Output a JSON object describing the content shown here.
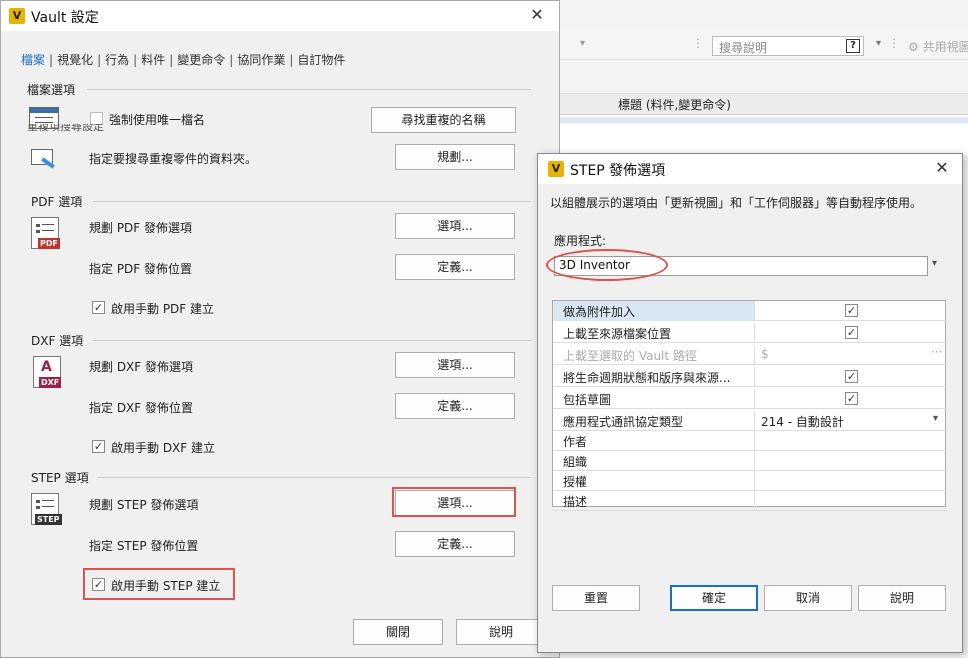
{
  "background": {
    "search_placeholder": "搜尋說明",
    "help_glyph": "?",
    "share_label": "共用視圖",
    "column_title": "標題 (料件,變更命令)"
  },
  "vault_dialog": {
    "title": "Vault 設定",
    "logo": "V",
    "tabs": [
      "檔案",
      "視覺化",
      "行為",
      "料件",
      "變更命令",
      "協同作業",
      "自訂物件"
    ],
    "file_options": {
      "heading": "檔案選項",
      "unique_name_label": "強制使用唯一檔名",
      "find_dup_button": "尋找重複的名稱",
      "dup_search_heading": "重複項搜尋設定",
      "dup_search_label": "指定要搜尋重複零件的資料夾。",
      "plan_button": "規劃..."
    },
    "pdf": {
      "heading": "PDF 選項",
      "badge": "PDF",
      "plan_label": "規劃 PDF 發佈選項",
      "options_button": "選項...",
      "location_label": "指定 PDF 發佈位置",
      "define_button": "定義...",
      "manual_label": "啟用手動 PDF 建立"
    },
    "dxf": {
      "heading": "DXF 選項",
      "badge": "DXF",
      "plan_label": "規劃 DXF 發佈選項",
      "options_button": "選項...",
      "location_label": "指定 DXF 發佈位置",
      "define_button": "定義...",
      "manual_label": "啟用手動 DXF 建立"
    },
    "step": {
      "heading": "STEP 選項",
      "badge": "STEP",
      "plan_label": "規劃 STEP 發佈選項",
      "options_button": "選項...",
      "location_label": "指定 STEP 發佈位置",
      "define_button": "定義...",
      "manual_label": "啟用手動 STEP 建立"
    },
    "close_button": "關閉",
    "help_button": "說明"
  },
  "step_dialog": {
    "title": "STEP 發佈選項",
    "logo": "V",
    "description": "以組體展示的選項由「更新視圖」和「工作伺服器」等自動程序使用。",
    "app_label": "應用程式:",
    "app_value": "3D Inventor",
    "properties": [
      {
        "name": "做為附件加入",
        "value": "",
        "checked": true
      },
      {
        "name": "上載至來源檔案位置",
        "value": "",
        "checked": true
      },
      {
        "name": "上載至選取的 Vault 路徑",
        "value": "$",
        "checked": false
      },
      {
        "name": "將生命週期狀態和版序與來源...",
        "value": "",
        "checked": true
      },
      {
        "name": "包括草圖",
        "value": "",
        "checked": true
      },
      {
        "name": "應用程式通訊協定類型",
        "value": "214 - 自動設計",
        "checked": false
      },
      {
        "name": "作者",
        "value": "",
        "checked": false
      },
      {
        "name": "組織",
        "value": "",
        "checked": false
      },
      {
        "name": "授權",
        "value": "",
        "checked": false
      },
      {
        "name": "描述",
        "value": "",
        "checked": false
      }
    ],
    "reset_button": "重置",
    "ok_button": "確定",
    "cancel_button": "取消",
    "help_button": "說明"
  },
  "colors": {
    "accent": "#1a6fc2",
    "highlight_red": "#d9534f",
    "logo_yellow": "#e8b200",
    "pdf_red": "#c8302b",
    "dxf_red": "#9c2146",
    "step_dark": "#333333"
  }
}
